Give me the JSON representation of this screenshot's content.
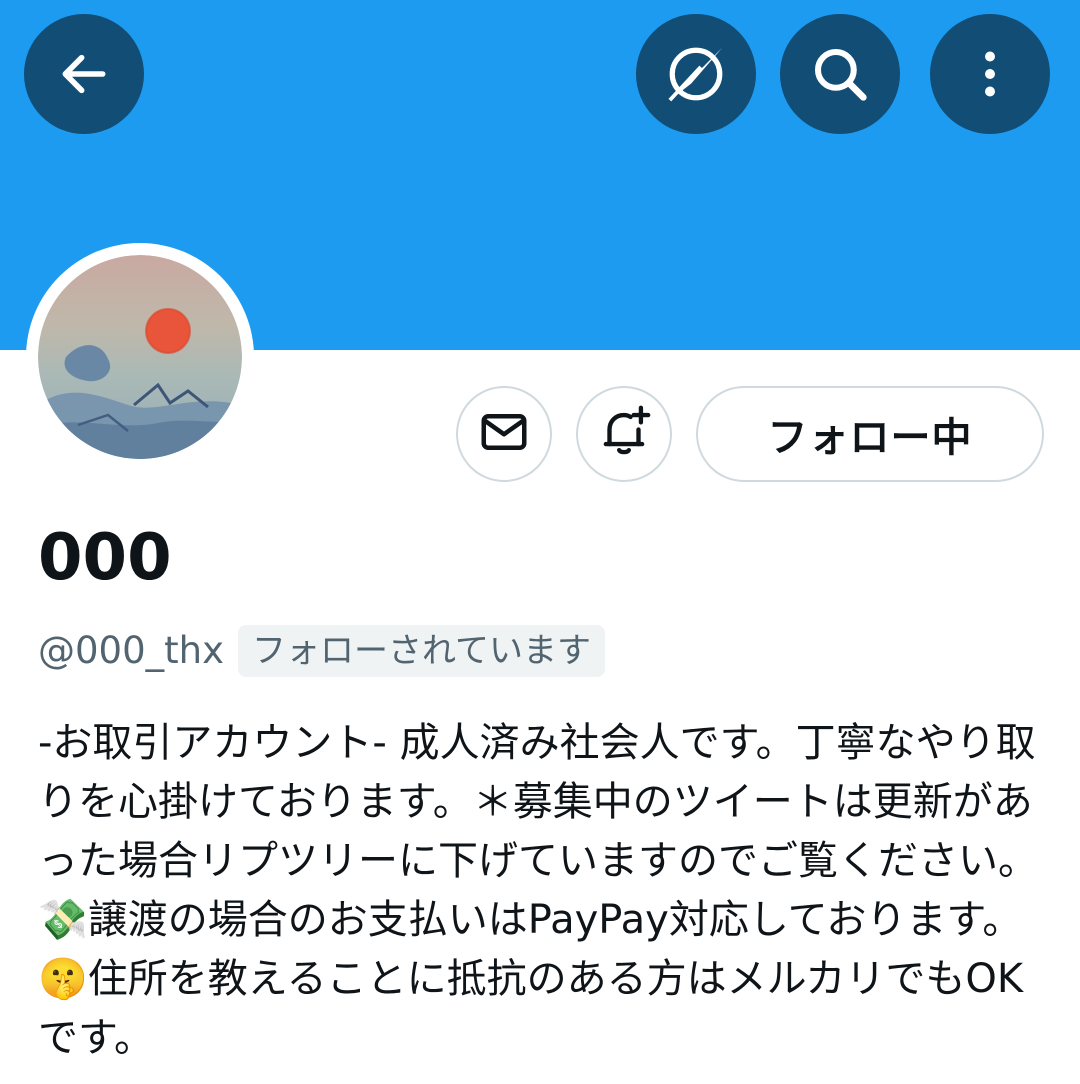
{
  "header": {
    "banner_color": "#1d9bf0",
    "button_color": "#114d75",
    "back_icon": "arrow-left-icon",
    "actions": [
      {
        "icon": "compass-icon"
      },
      {
        "icon": "search-icon"
      },
      {
        "icon": "more-vertical-icon"
      }
    ]
  },
  "profile": {
    "display_name": "000",
    "handle": "@000_thx",
    "follows_you_label": "フォローされています",
    "follow_button_label": "フォロー中",
    "message_icon": "mail-icon",
    "notify_icon": "bell-plus-icon",
    "bio": "-お取引アカウント- 成人済み社会人です。丁寧なやり取りを心掛けております。＊募集中のツイートは更新があった場合リプツリーに下げていますのでご覧ください。💸譲渡の場合のお支払いはPayPay対応しております。🤫住所を教えることに抵抗のある方はメルカリでもOKです。"
  }
}
